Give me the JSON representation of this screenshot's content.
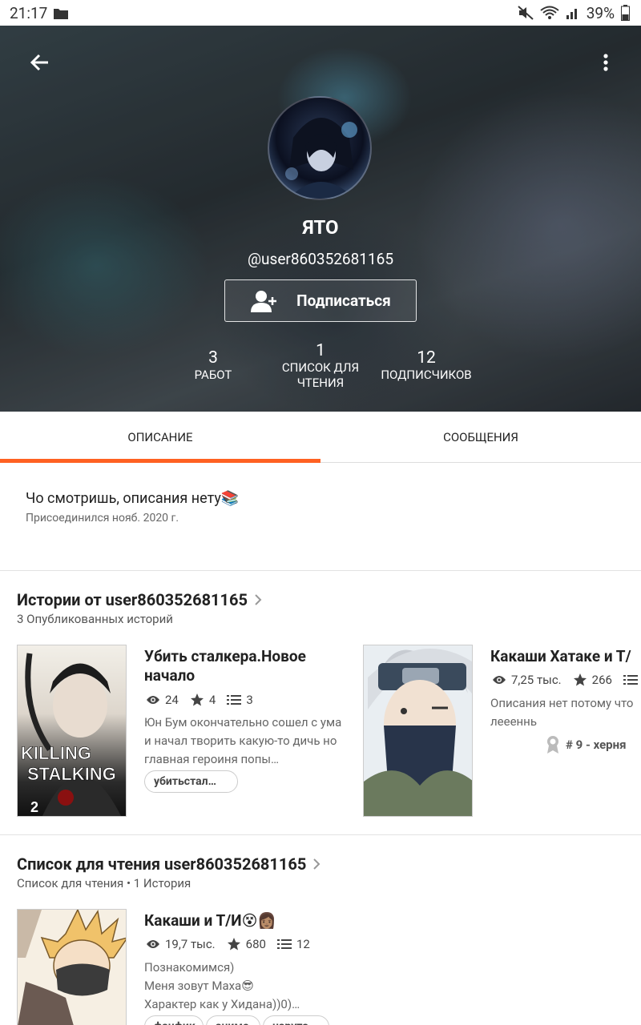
{
  "status": {
    "time": "21:17",
    "battery": "39%"
  },
  "profile": {
    "display_name": "ЯТО",
    "username": "@user860352681165",
    "follow_label": "Подписаться",
    "stats": [
      {
        "value": "3",
        "label": "РАБОТ"
      },
      {
        "value": "1",
        "label": "СПИСОК ДЛЯ ЧТЕНИЯ"
      },
      {
        "value": "12",
        "label": "ПОДПИСЧИКОВ"
      }
    ]
  },
  "tabs": [
    {
      "label": "ОПИСАНИЕ",
      "active": true
    },
    {
      "label": "СООБЩЕНИЯ",
      "active": false
    }
  ],
  "about": {
    "description": "Чо смотришь, описания нету📚",
    "joined": "Присоединился нояб. 2020 г."
  },
  "stories_section": {
    "title": "Истории от user860352681165",
    "subtitle": "3 Опубликованных историй",
    "items": [
      {
        "title": "Убить сталкера.Новое начало",
        "views": "24",
        "votes": "4",
        "parts": "3",
        "description": "Юн Бум окончательно сошел с ума и начал творить какую-то дичь но главная героиня попы…",
        "tags": [
          "убитьстал…"
        ],
        "cover_text": [
          "KILLING",
          "STALKING",
          "2"
        ]
      },
      {
        "title": "Какаши Хатаке и Т/",
        "views": "7,25 тыс.",
        "votes": "266",
        "parts": "",
        "description": "Описания нет потому что леееннь",
        "rank": "# 9 - херня"
      }
    ]
  },
  "reading_section": {
    "title": "Список для чтения user860352681165",
    "subtitle": "Список для чтения • 1 История",
    "items": [
      {
        "title": "Какаши и Т/И😵👩🏽",
        "views": "19,7 тыс.",
        "votes": "680",
        "parts": "12",
        "description_lines": [
          "Познакомимся)",
          "Меня  зовут Маха😎",
          "Характер как у Хидана))0)…"
        ],
        "tags": [
          "фанфик",
          "аниме",
          "наруто"
        ]
      }
    ]
  },
  "icons": {
    "back": "arrow-left-icon",
    "more": "more-vert-icon",
    "follow": "add-person-icon",
    "views": "eye-icon",
    "votes": "star-icon",
    "parts": "list-icon",
    "rank": "ribbon-icon",
    "chevron": "chevron-right-icon"
  },
  "colors": {
    "accent": "#ff6122"
  }
}
